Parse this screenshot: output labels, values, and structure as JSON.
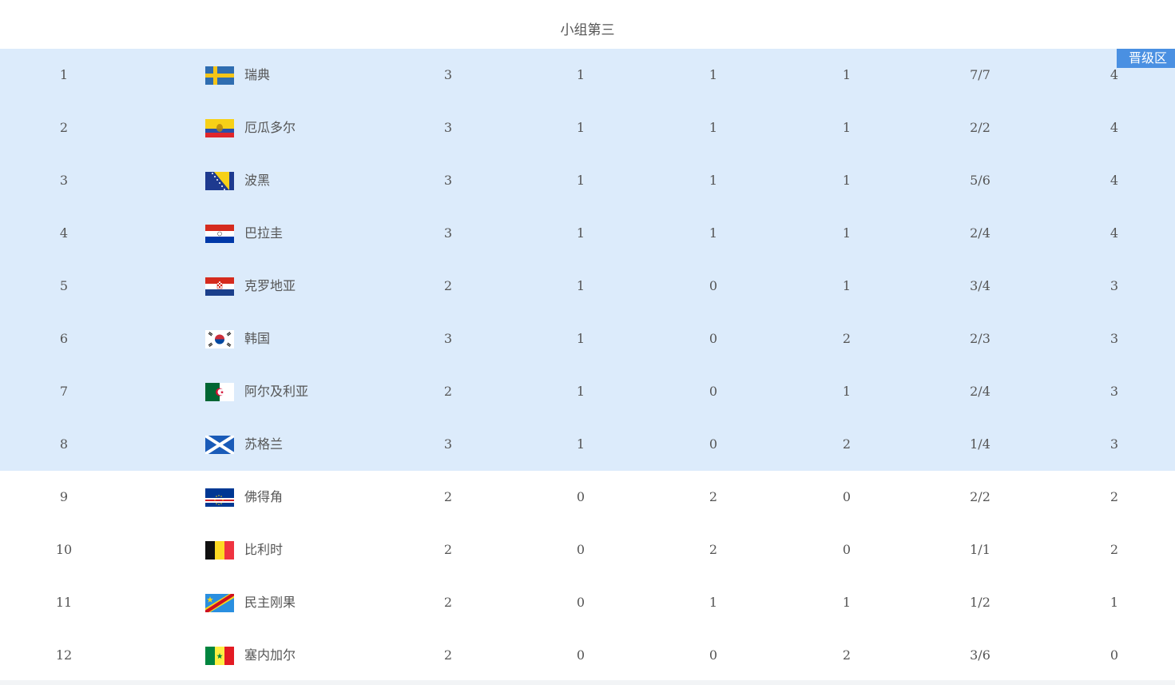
{
  "group_title": "小组第三",
  "advance_badge": "晋级区",
  "colors": {
    "advance_row_bg": "#dcebfb",
    "badge_bg": "#4a90e2"
  },
  "rows": [
    {
      "rank": "1",
      "team": "瑞典",
      "flag": "sweden-flag-icon",
      "played": "3",
      "won": "1",
      "drawn": "1",
      "lost": "1",
      "goals": "7/7",
      "points": "4",
      "advance": true
    },
    {
      "rank": "2",
      "team": "厄瓜多尔",
      "flag": "ecuador-flag-icon",
      "played": "3",
      "won": "1",
      "drawn": "1",
      "lost": "1",
      "goals": "2/2",
      "points": "4",
      "advance": true
    },
    {
      "rank": "3",
      "team": "波黑",
      "flag": "bosnia-flag-icon",
      "played": "3",
      "won": "1",
      "drawn": "1",
      "lost": "1",
      "goals": "5/6",
      "points": "4",
      "advance": true
    },
    {
      "rank": "4",
      "team": "巴拉圭",
      "flag": "paraguay-flag-icon",
      "played": "3",
      "won": "1",
      "drawn": "1",
      "lost": "1",
      "goals": "2/4",
      "points": "4",
      "advance": true
    },
    {
      "rank": "5",
      "team": "克罗地亚",
      "flag": "croatia-flag-icon",
      "played": "2",
      "won": "1",
      "drawn": "0",
      "lost": "1",
      "goals": "3/4",
      "points": "3",
      "advance": true
    },
    {
      "rank": "6",
      "team": "韩国",
      "flag": "south-korea-flag-icon",
      "played": "3",
      "won": "1",
      "drawn": "0",
      "lost": "2",
      "goals": "2/3",
      "points": "3",
      "advance": true
    },
    {
      "rank": "7",
      "team": "阿尔及利亚",
      "flag": "algeria-flag-icon",
      "played": "2",
      "won": "1",
      "drawn": "0",
      "lost": "1",
      "goals": "2/4",
      "points": "3",
      "advance": true
    },
    {
      "rank": "8",
      "team": "苏格兰",
      "flag": "scotland-flag-icon",
      "played": "3",
      "won": "1",
      "drawn": "0",
      "lost": "2",
      "goals": "1/4",
      "points": "3",
      "advance": true
    },
    {
      "rank": "9",
      "team": "佛得角",
      "flag": "cape-verde-flag-icon",
      "played": "2",
      "won": "0",
      "drawn": "2",
      "lost": "0",
      "goals": "2/2",
      "points": "2",
      "advance": false
    },
    {
      "rank": "10",
      "team": "比利时",
      "flag": "belgium-flag-icon",
      "played": "2",
      "won": "0",
      "drawn": "2",
      "lost": "0",
      "goals": "1/1",
      "points": "2",
      "advance": false
    },
    {
      "rank": "11",
      "team": "民主刚果",
      "flag": "dr-congo-flag-icon",
      "played": "2",
      "won": "0",
      "drawn": "1",
      "lost": "1",
      "goals": "1/2",
      "points": "1",
      "advance": false
    },
    {
      "rank": "12",
      "team": "塞内加尔",
      "flag": "senegal-flag-icon",
      "played": "2",
      "won": "0",
      "drawn": "0",
      "lost": "2",
      "goals": "3/6",
      "points": "0",
      "advance": false
    }
  ]
}
